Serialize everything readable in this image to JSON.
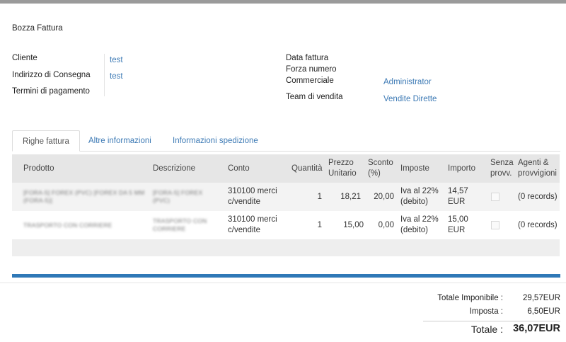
{
  "document": {
    "title": "Bozza Fattura"
  },
  "header_left": {
    "customer_label": "Cliente",
    "customer_value": "test",
    "delivery_label": "Indirizzo di Consegna",
    "delivery_value": "test",
    "terms_label": "Termini di pagamento"
  },
  "header_right": {
    "invoice_date_label": "Data fattura",
    "force_number_label": "Forza numero",
    "salesperson_label": "Commerciale",
    "salesperson_value": "Administrator",
    "sales_team_label": "Team di vendita",
    "sales_team_value": "Vendite Dirette"
  },
  "tabs": [
    {
      "label": "Righe fattura",
      "active": true
    },
    {
      "label": "Altre informazioni",
      "active": false
    },
    {
      "label": "Informazioni spedizione",
      "active": false
    }
  ],
  "table": {
    "columns": {
      "product": "Prodotto",
      "description": "Descrizione",
      "account": "Conto",
      "quantity": "Quantità",
      "unit_price": "Prezzo Unitario",
      "discount": "Sconto (%)",
      "taxes": "Imposte",
      "amount": "Importo",
      "no_commission": "Senza provv.",
      "agents": "Agenti & provvigioni"
    },
    "rows": [
      {
        "product": "[FORA-5] FOREX (PVC) [FOREX DA 5 MM (FORA-5)]",
        "description": "[FORA-5] FOREX (PVC)",
        "account": "310100 merci c/vendite",
        "quantity": "1",
        "unit_price": "18,21",
        "discount": "20,00",
        "taxes": "Iva al 22% (debito)",
        "amount": "14,57 EUR",
        "agents": "(0 records)"
      },
      {
        "product": "TRASPORTO CON CORRIERE",
        "description": "TRASPORTO CON CORRIERE",
        "account": "310100 merci c/vendite",
        "quantity": "1",
        "unit_price": "15,00",
        "discount": "0,00",
        "taxes": "Iva al 22% (debito)",
        "amount": "15,00 EUR",
        "agents": "(0 records)"
      }
    ]
  },
  "totals": {
    "untaxed_label": "Totale Imponibile :",
    "untaxed_value": "29,57EUR",
    "tax_label": "Imposta :",
    "tax_value": "6,50EUR",
    "total_label": "Totale :",
    "total_value": "36,07EUR"
  }
}
